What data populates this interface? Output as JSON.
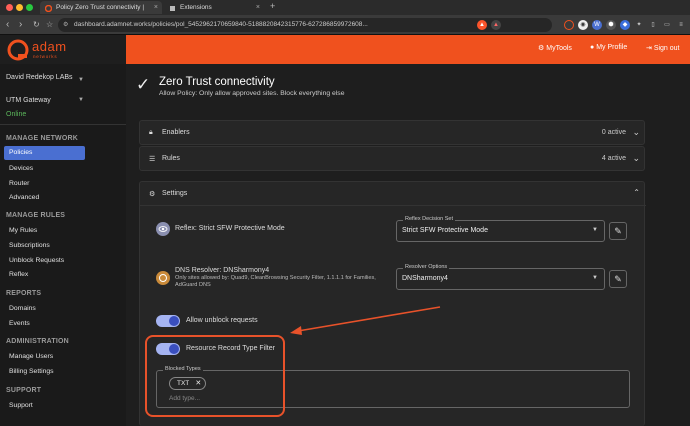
{
  "browser": {
    "tabs": [
      {
        "label": "Policy Zero Trust connectivity |",
        "close": "×"
      },
      {
        "label": "Extensions",
        "close": "×"
      }
    ],
    "new_tab": "+",
    "url": "dashboard.adamnet.works/policies/pol_5452962170659840-5188820842315776-627286859972608..."
  },
  "header": {
    "brand": "adam",
    "brand_sub": "networks",
    "links": [
      {
        "label": "MyTools"
      },
      {
        "label": "My Profile"
      },
      {
        "label": "Sign out"
      }
    ]
  },
  "sidebar": {
    "org": "David Redekop LABs",
    "gateway": "UTM Gateway",
    "status": "Online",
    "sections": [
      {
        "title": "MANAGE NETWORK",
        "items": [
          "Policies",
          "Devices",
          "Router",
          "Advanced"
        ]
      },
      {
        "title": "MANAGE RULES",
        "items": [
          "My Rules",
          "Subscriptions",
          "Unblock Requests",
          "Reflex"
        ]
      },
      {
        "title": "REPORTS",
        "items": [
          "Domains",
          "Events"
        ]
      },
      {
        "title": "ADMINISTRATION",
        "items": [
          "Manage Users",
          "Billing Settings"
        ]
      },
      {
        "title": "SUPPORT",
        "items": [
          "Support"
        ]
      }
    ]
  },
  "policy": {
    "title": "Zero Trust connectivity",
    "subtitle": "Allow Policy: Only allow approved sites. Block everything else"
  },
  "panels": {
    "enablers": {
      "label": "Enablers",
      "count": "0 active"
    },
    "rules": {
      "label": "Rules",
      "count": "4 active"
    },
    "settings": {
      "label": "Settings"
    }
  },
  "settings": {
    "reflex": {
      "label": "Reflex: Strict SFW Protective Mode",
      "legend": "Reflex Decision Set",
      "value": "Strict SFW Protective Mode"
    },
    "dns": {
      "label": "DNS Resolver: DNSharmony4",
      "desc_line1": "Only sites allowed by: Quad9, CleanBrowsing Security Filter, 1.1.1.1 for Families,",
      "desc_line2": "AdGuard DNS",
      "legend": "Resolver Options",
      "value": "DNSharmony4"
    },
    "allow_unblock": {
      "label": "Allow unblock requests",
      "on": true
    },
    "rr_filter": {
      "label": "Resource Record Type Filter",
      "on": true
    },
    "blocked_types": {
      "legend": "Blocked Types",
      "chips": [
        "TXT"
      ],
      "placeholder": "Add type..."
    }
  },
  "colors": {
    "brand_orange": "#f0511e",
    "active_blue": "#4a6fd1",
    "online_green": "#5cb85c",
    "annotation_red": "#e8522a"
  }
}
